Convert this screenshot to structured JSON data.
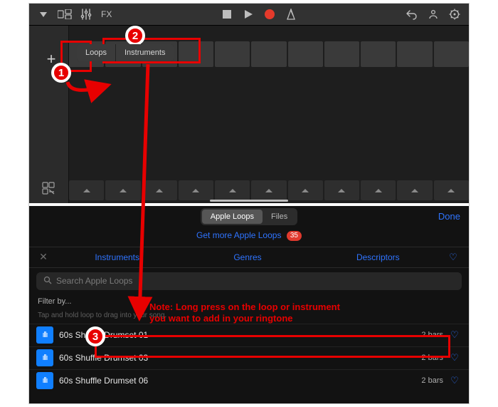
{
  "topbar": {
    "fx_label": "FX"
  },
  "segment": {
    "loops": "Loops",
    "instruments": "Instruments"
  },
  "lower": {
    "segmented": {
      "apple_loops": "Apple Loops",
      "files": "Files"
    },
    "done": "Done",
    "getmore_text": "Get more Apple Loops",
    "getmore_badge": "35",
    "tabs": {
      "instruments": "Instruments",
      "genres": "Genres",
      "descriptors": "Descriptors"
    },
    "search_placeholder": "Search Apple Loops",
    "filter_label": "Filter by...",
    "hint": "Tap and hold loop to drag into your song.",
    "rows": [
      {
        "name": "60s Shuffle Drumset 01",
        "bars": "2 bars"
      },
      {
        "name": "60s Shuffle Drumset 03",
        "bars": "2 bars"
      },
      {
        "name": "60s Shuffle Drumset 06",
        "bars": "2 bars"
      }
    ]
  },
  "annotation": {
    "one": "1",
    "two": "2",
    "three": "3",
    "note_l1": "Note: Long press on the loop or instrument",
    "note_l2": "you want to add in your ringtone"
  }
}
